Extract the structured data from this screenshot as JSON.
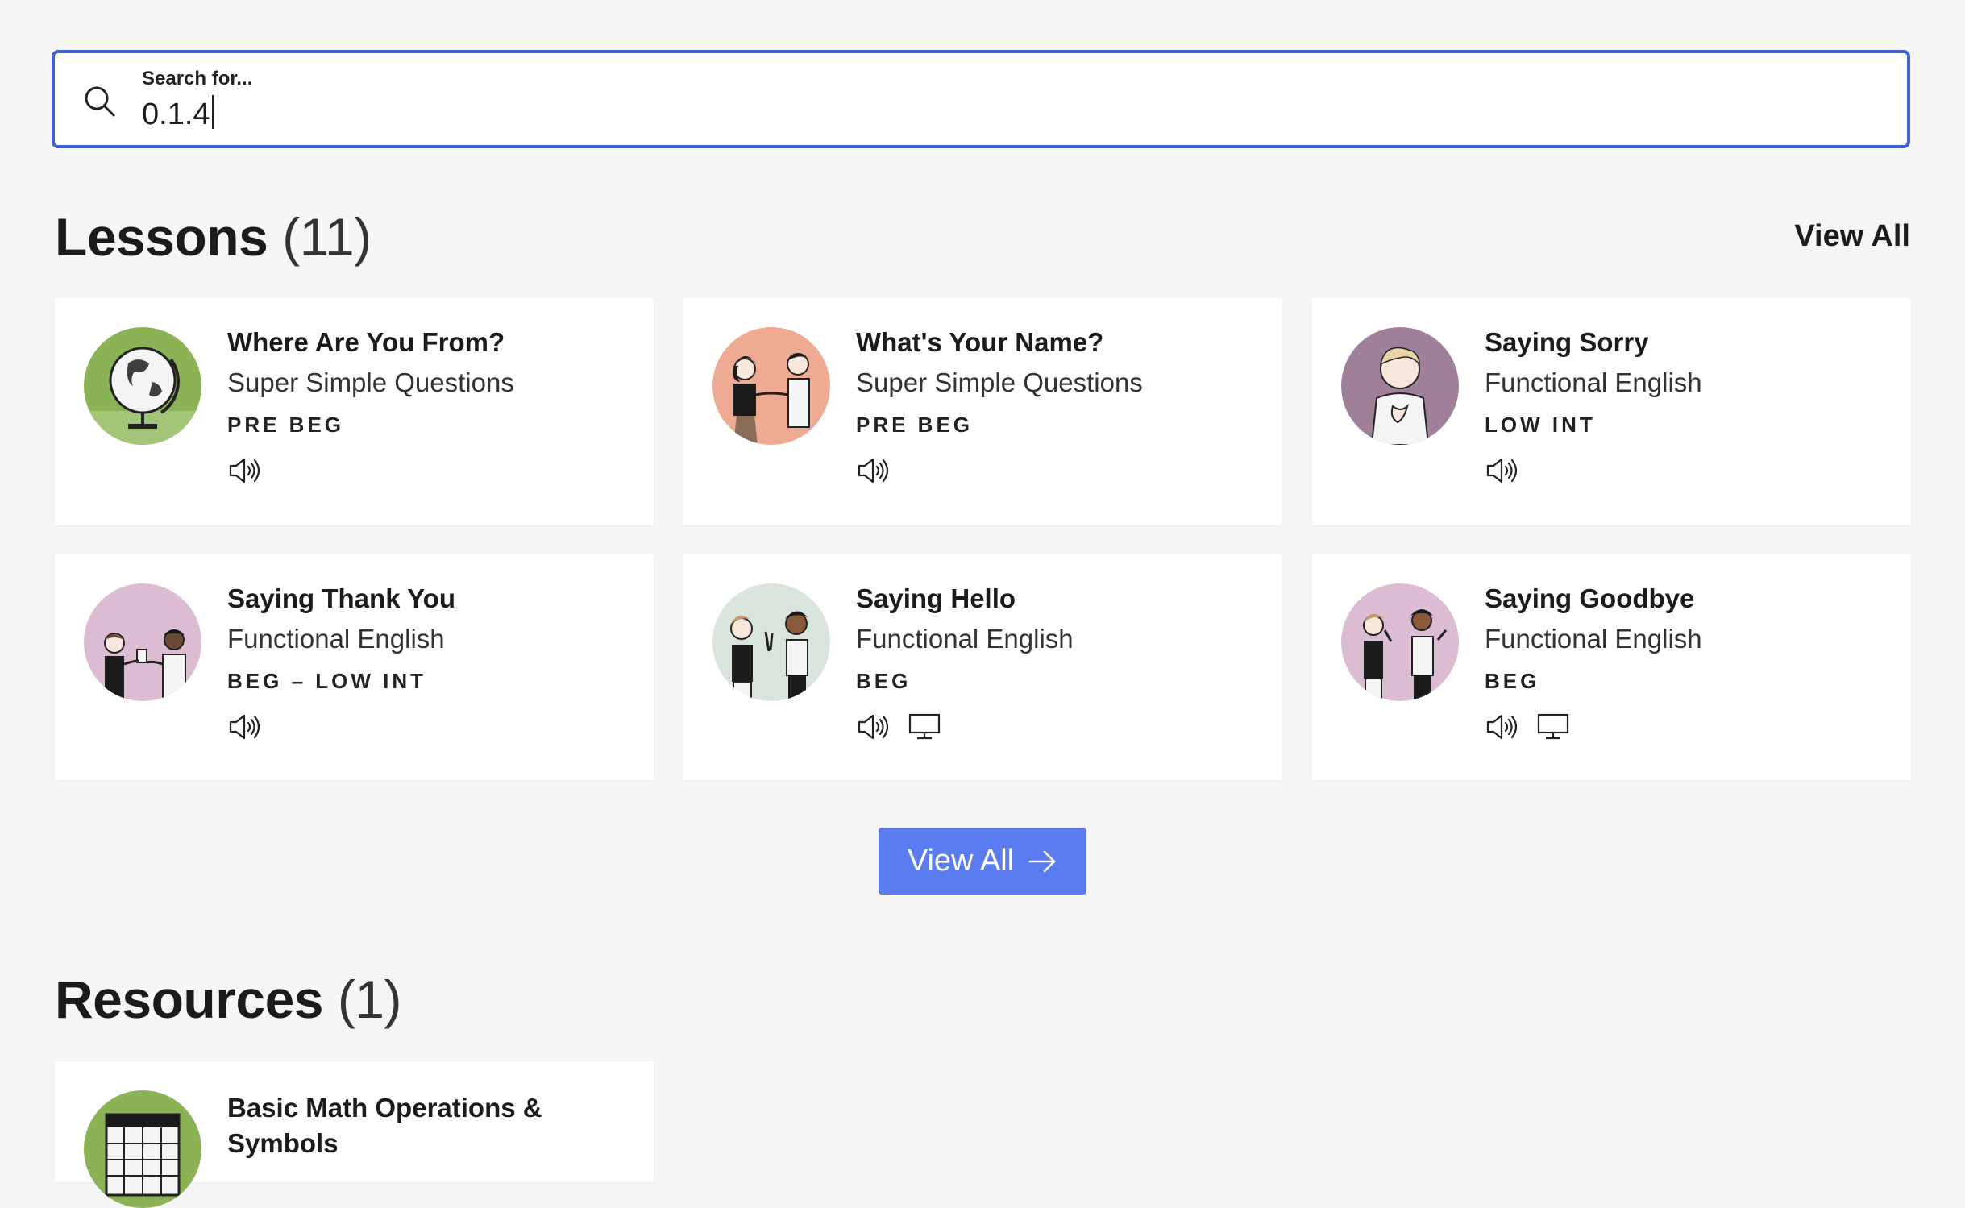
{
  "search": {
    "label": "Search for...",
    "value": "0.1.4"
  },
  "lessons": {
    "heading": "Lessons",
    "count": "(11)",
    "view_all": "View All",
    "items": [
      {
        "title": "Where Are You From?",
        "subtitle": "Super Simple Questions",
        "level": "PRE BEG",
        "icons": [
          "audio-icon"
        ],
        "bg": "#8bb356"
      },
      {
        "title": "What's Your Name?",
        "subtitle": "Super Simple Questions",
        "level": "PRE BEG",
        "icons": [
          "audio-icon"
        ],
        "bg": "#eeaa92"
      },
      {
        "title": "Saying Sorry",
        "subtitle": "Functional English",
        "level": "LOW INT",
        "icons": [
          "audio-icon"
        ],
        "bg": "#a07f9b"
      },
      {
        "title": "Saying Thank You",
        "subtitle": "Functional English",
        "level": "BEG – LOW INT",
        "icons": [
          "audio-icon"
        ],
        "bg": "#dcbcd2"
      },
      {
        "title": "Saying Hello",
        "subtitle": "Functional English",
        "level": "BEG",
        "icons": [
          "audio-icon",
          "monitor-icon"
        ],
        "bg": "#d9e4dc"
      },
      {
        "title": "Saying Goodbye",
        "subtitle": "Functional English",
        "level": "BEG",
        "icons": [
          "audio-icon",
          "monitor-icon"
        ],
        "bg": "#dcbcd2"
      }
    ],
    "button_label": "View All"
  },
  "resources": {
    "heading": "Resources",
    "count": "(1)",
    "items": [
      {
        "title": "Basic Math Operations & Symbols",
        "bg": "#8bb356"
      }
    ]
  },
  "colors": {
    "accent": "#3f5fd9",
    "button": "#5b7bf0",
    "background": "#f5f5f5"
  }
}
